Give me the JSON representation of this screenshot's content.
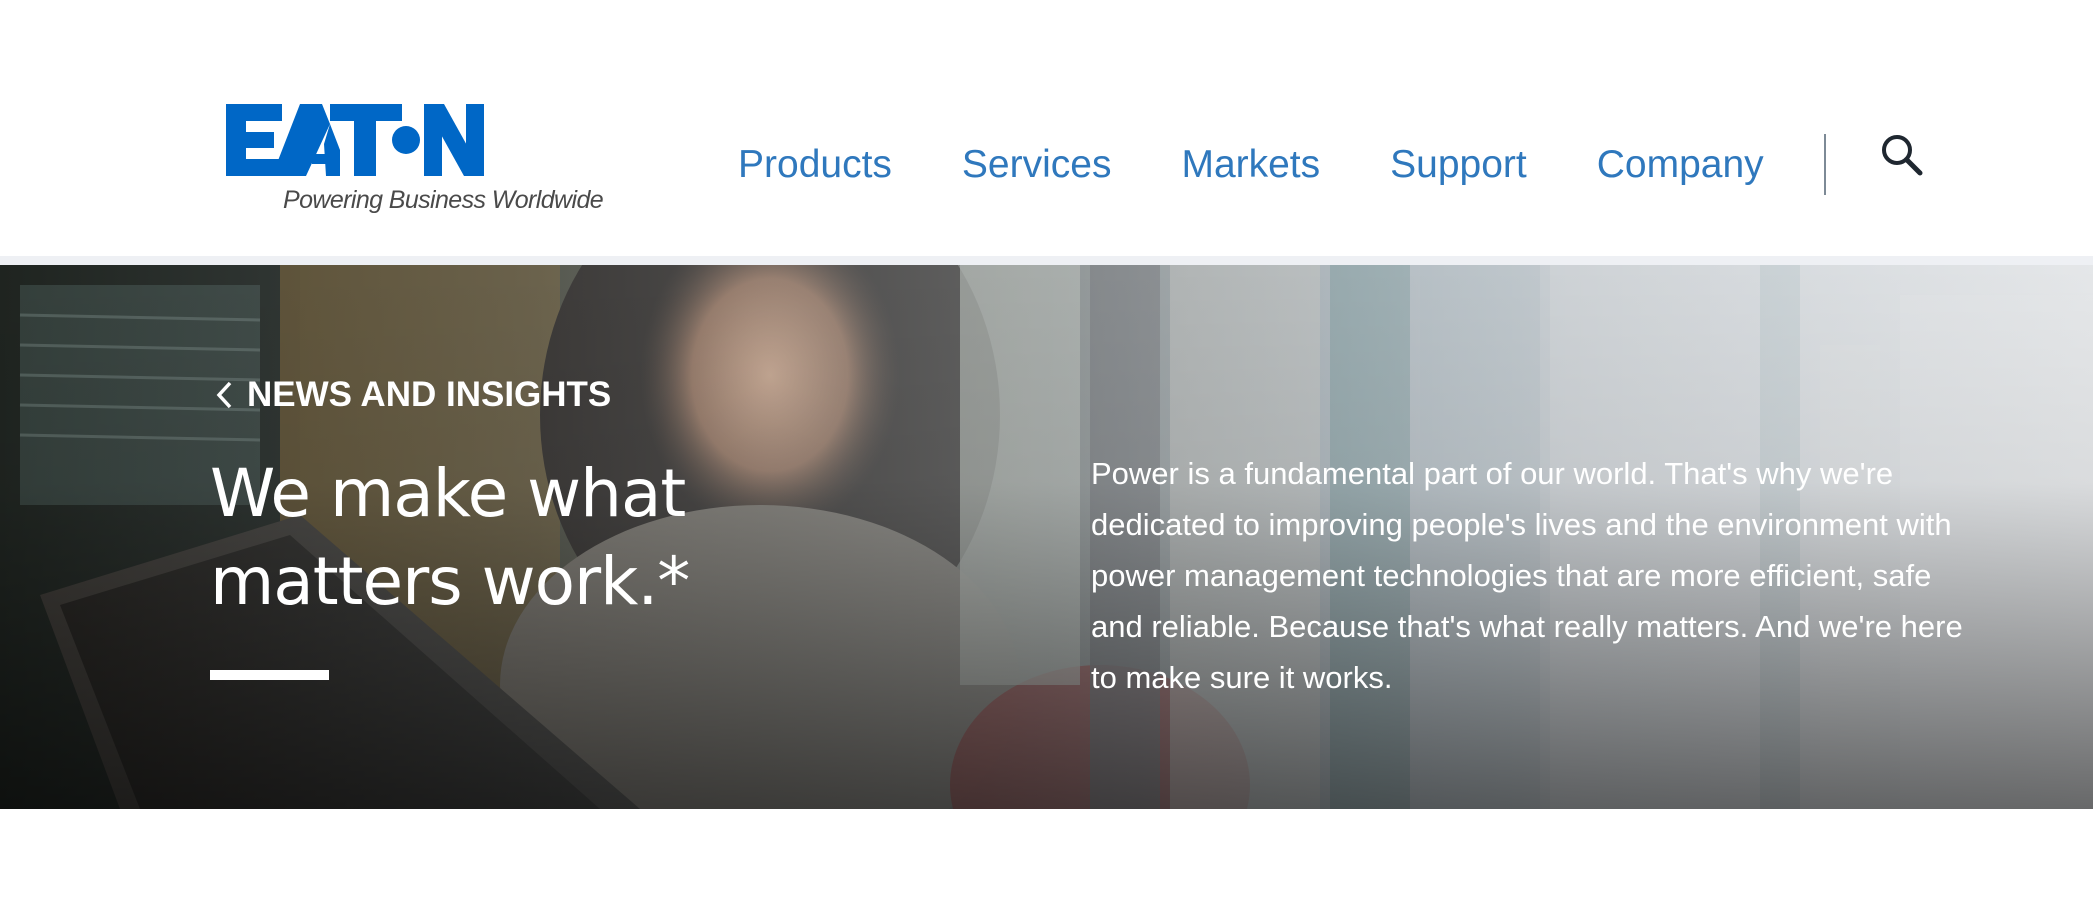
{
  "header": {
    "logo": {
      "brand": "EATON",
      "tagline": "Powering Business Worldwide",
      "color": "#0067c6"
    },
    "nav": [
      {
        "label": "Products"
      },
      {
        "label": "Services"
      },
      {
        "label": "Markets"
      },
      {
        "label": "Support"
      },
      {
        "label": "Company"
      }
    ],
    "search_icon": "search-icon",
    "nav_color": "#2f78bd"
  },
  "hero": {
    "breadcrumb_icon": "chevron-left-icon",
    "breadcrumb": "NEWS AND INSIGHTS",
    "title": "We make what matters work.*",
    "description": "Power is a fundamental part of our world. That's why we're dedicated to improving people's lives and the environment with power management technologies that are more efficient, safe and reliable. Because that's what really matters. And we're here to make sure it works."
  }
}
